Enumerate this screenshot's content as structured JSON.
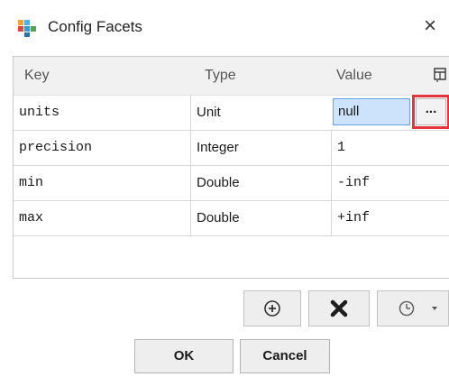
{
  "window": {
    "title": "Config Facets",
    "close_glyph": "×",
    "icon": "config-facets-app-icon"
  },
  "table": {
    "headers": {
      "key": "Key",
      "type": "Type",
      "value": "Value"
    },
    "rows": [
      {
        "key": "units",
        "type": "Unit",
        "value": "null"
      },
      {
        "key": "precision",
        "type": "Integer",
        "value": "1"
      },
      {
        "key": "min",
        "type": "Double",
        "value": "-inf"
      },
      {
        "key": "max",
        "type": "Double",
        "value": "+inf"
      }
    ],
    "editor_button": "..."
  },
  "toolbar": {
    "add_icon": "add-circle-icon",
    "delete_icon": "delete-x-icon",
    "history_icon": "clock-icon"
  },
  "buttons": {
    "ok": "OK",
    "cancel": "Cancel"
  },
  "colors": {
    "selection": "#cde2fb",
    "highlight_border": "#e2353f"
  }
}
